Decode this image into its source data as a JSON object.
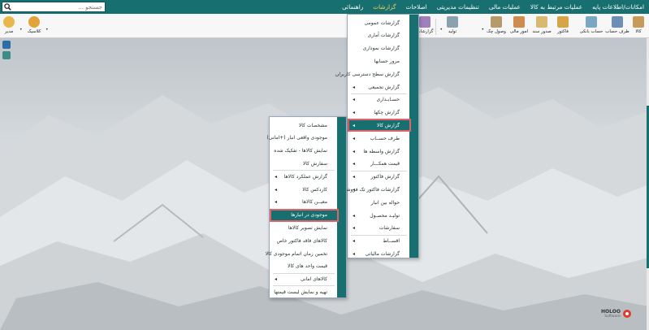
{
  "menubar": {
    "items": [
      "امکانات/اطلاعات پایه",
      "عملیات مرتبط به کالا",
      "عملیات مالی",
      "تنظیمات مدیریتی",
      "اصلاحات",
      "گزارشات",
      "راهنمائی"
    ],
    "active_index": 5
  },
  "search": {
    "placeholder": "جستجو ..."
  },
  "toolbar": {
    "items": [
      {
        "label": "کالا",
        "icon": "box-icon",
        "color": "#c79a5a"
      },
      {
        "label": "طرف حساب",
        "icon": "person-icon",
        "color": "#6d8fb6"
      },
      {
        "label": "حساب بانکی",
        "icon": "bank-icon",
        "color": "#7ba7c7"
      },
      {
        "label": "فاکتور",
        "icon": "invoice-icon",
        "color": "#d6a548"
      },
      {
        "label": "صدور سند",
        "icon": "document-icon",
        "color": "#d9b96f"
      },
      {
        "label": "امور مالی",
        "icon": "finance-icon",
        "color": "#cf8c4f"
      },
      {
        "label": "وصول چک",
        "icon": "cheque-icon",
        "color": "#b69a6a"
      },
      {
        "label": "تولید",
        "icon": "factory-icon",
        "color": "#8aa2b0"
      },
      {
        "label": "گزارشات",
        "icon": "report-icon",
        "color": "#9f7fbd"
      }
    ],
    "left_items": [
      {
        "label": "کلاسیک",
        "icon": "classic-icon",
        "color": "#e3a23c"
      },
      {
        "label": "مدیر",
        "icon": "manager-icon",
        "color": "#e9b84d"
      }
    ]
  },
  "main_menu": {
    "items": [
      {
        "label": "گزارشات عمومی",
        "arrow": false
      },
      {
        "label": "گزارشات آماری",
        "arrow": false
      },
      {
        "label": "گزارشات نموداری",
        "arrow": false
      },
      {
        "label": "مرور حسابها",
        "arrow": false
      },
      {
        "label": "گزارش سطح دسترسی کاربران",
        "arrow": false
      },
      {
        "label": "گزارش تجمیعی",
        "arrow": true
      },
      {
        "label": "حسـابـداری",
        "arrow": true
      },
      {
        "label": "گزارش چکها",
        "arrow": true
      },
      {
        "label": "گزارش کالا",
        "arrow": true
      },
      {
        "label": "طرف حســاب",
        "arrow": true
      },
      {
        "label": "گزارش واسطه ها",
        "arrow": true
      },
      {
        "label": "قیمت همکـــار",
        "arrow": true
      },
      {
        "label": "گزارش فاکتور",
        "arrow": true
      },
      {
        "label": "گزارشات فاکتور تک فروشی",
        "arrow": true
      },
      {
        "label": "حواله بین انبار",
        "arrow": false
      },
      {
        "label": "تولیـد محصـول",
        "arrow": true
      },
      {
        "label": "سفارشات",
        "arrow": true
      },
      {
        "label": "اقســاط",
        "arrow": true
      },
      {
        "label": "گزارشات مالیاتی",
        "arrow": true
      }
    ],
    "highlighted_index": 8
  },
  "sub_menu": {
    "items": [
      {
        "label": "مشخصات کالا",
        "arrow": false
      },
      {
        "label": "موجودی واقعی انبار (+امانی)",
        "arrow": false
      },
      {
        "label": "نمایش کالاها - تفکیک شده",
        "arrow": false
      },
      {
        "label": "سفارش کالا",
        "arrow": false
      },
      {
        "label": "گزارش عملکرد کالاها",
        "arrow": true
      },
      {
        "label": "کاردکس کالا",
        "arrow": true
      },
      {
        "label": "معیــن کالاها",
        "arrow": true
      },
      {
        "label": "موجودی در انبارها",
        "arrow": false
      },
      {
        "label": "نمایش تصویر کالاها",
        "arrow": false
      },
      {
        "label": "کالاهای فاقد فاکتور خاص",
        "arrow": false
      },
      {
        "label": "تخمین زمان اتمام موجودی کالا",
        "arrow": false
      },
      {
        "label": "قیمت واحد های کالا",
        "arrow": false
      },
      {
        "label": "کالاهای امانی",
        "arrow": true
      },
      {
        "label": "تهیه و نمایش لیست قیمتها",
        "arrow": false
      }
    ],
    "highlighted_index": 7
  },
  "logo": {
    "brand": "HOLOO",
    "sub": "Software"
  },
  "colors": {
    "teal": "#17706f",
    "accent": "#ffd45a",
    "highlight_box": "#e0636a"
  }
}
